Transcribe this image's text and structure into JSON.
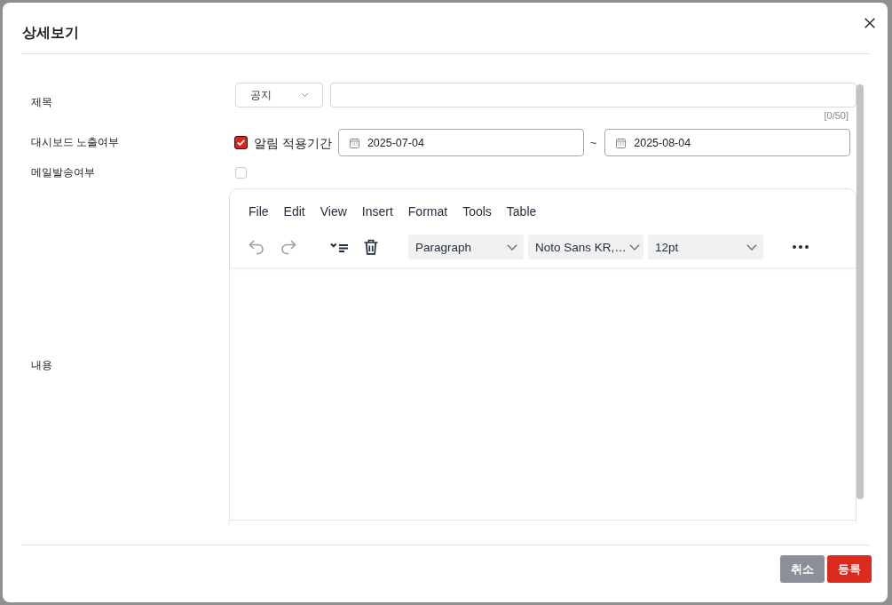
{
  "dialog": {
    "title": "상세보기"
  },
  "fields": [
    {
      "kind": "title",
      "label": "제목",
      "category": "공지",
      "counter": "[0/50]"
    },
    {
      "kind": "period",
      "label": "대시보드 노출여부",
      "checked": true,
      "option": "알림 적용기간",
      "start": {
        "value": "2025-07-04",
        "invalid": true
      },
      "separator": "~",
      "end": {
        "value": "2025-08-04",
        "invalid": true
      }
    },
    {
      "kind": "checkbox",
      "label": "메일발송여부",
      "checked": false
    },
    {
      "kind": "editor",
      "label": "내용",
      "menu": [
        "File",
        "Edit",
        "View",
        "Insert",
        "Format",
        "Tools",
        "Table"
      ],
      "toolbar": [
        {
          "kind": "undo",
          "disabled": true
        },
        {
          "kind": "redo",
          "disabled": true
        },
        {
          "kind": "collapse",
          "disabled": false
        },
        {
          "kind": "delete",
          "disabled": false
        },
        {
          "kind": "select",
          "value": "Paragraph",
          "disabled": false
        },
        {
          "kind": "select",
          "value": "Noto Sans KR,…",
          "disabled": false
        },
        {
          "kind": "select",
          "value": "12pt",
          "disabled": false
        },
        {
          "kind": "more",
          "disabled": false
        }
      ]
    }
  ],
  "buttons": [
    {
      "label": "취소",
      "kind": "secondary"
    },
    {
      "label": "등록",
      "kind": "primary"
    }
  ]
}
